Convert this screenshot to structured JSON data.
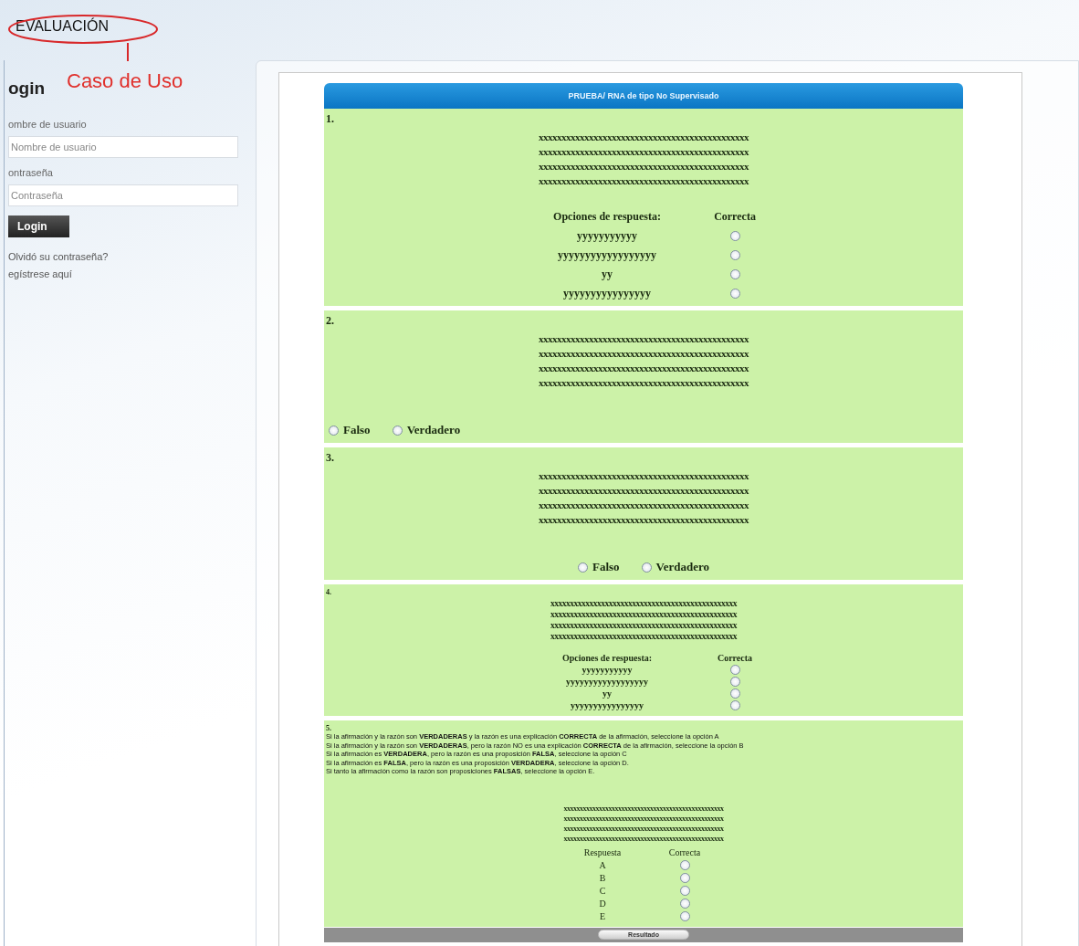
{
  "header": {
    "title": "EVALUACIÓN"
  },
  "annotation": {
    "label": "Caso de Uso"
  },
  "login": {
    "heading": "ogin",
    "fields": [
      {
        "label": "ombre de usuario",
        "placeholder": "Nombre de usuario"
      },
      {
        "label": "ontraseña",
        "placeholder": "Contraseña"
      }
    ],
    "button": "Login",
    "links": [
      "Olvidó su contraseña?",
      "egístrese aquí"
    ]
  },
  "test": {
    "title": "PRUEBA/ RNA de tipo No Supervisado",
    "questions": [
      {
        "kind": "multiple",
        "number": "1.",
        "statement": [
          "xxxxxxxxxxxxxxxxxxxxxxxxxxxxxxxxxxxxxxxxxxxxxx",
          "xxxxxxxxxxxxxxxxxxxxxxxxxxxxxxxxxxxxxxxxxxxxxx",
          "xxxxxxxxxxxxxxxxxxxxxxxxxxxxxxxxxxxxxxxxxxxxxx",
          "xxxxxxxxxxxxxxxxxxxxxxxxxxxxxxxxxxxxxxxxxxxxxx"
        ],
        "options_header": "Opciones de respuesta:",
        "correct_header": "Correcta",
        "options": [
          {
            "text": "yyyyyyyyyyy",
            "selected": false
          },
          {
            "text": "yyyyyyyyyyyyyyyyyy",
            "selected": false
          },
          {
            "text": "yy",
            "selected": false
          },
          {
            "text": "yyyyyyyyyyyyyyyy",
            "selected": false
          }
        ]
      },
      {
        "kind": "truefalse",
        "number": "2.",
        "centered": false,
        "statement": [
          "xxxxxxxxxxxxxxxxxxxxxxxxxxxxxxxxxxxxxxxxxxxxxx",
          "xxxxxxxxxxxxxxxxxxxxxxxxxxxxxxxxxxxxxxxxxxxxxx",
          "xxxxxxxxxxxxxxxxxxxxxxxxxxxxxxxxxxxxxxxxxxxxxx",
          "xxxxxxxxxxxxxxxxxxxxxxxxxxxxxxxxxxxxxxxxxxxxxx"
        ],
        "options": [
          {
            "text": "Falso",
            "selected": false
          },
          {
            "text": "Verdadero",
            "selected": false
          }
        ]
      },
      {
        "kind": "truefalse",
        "number": "3.",
        "centered": true,
        "statement": [
          "xxxxxxxxxxxxxxxxxxxxxxxxxxxxxxxxxxxxxxxxxxxxxx",
          "xxxxxxxxxxxxxxxxxxxxxxxxxxxxxxxxxxxxxxxxxxxxxx",
          "xxxxxxxxxxxxxxxxxxxxxxxxxxxxxxxxxxxxxxxxxxxxxx",
          "xxxxxxxxxxxxxxxxxxxxxxxxxxxxxxxxxxxxxxxxxxxxxx"
        ],
        "options": [
          {
            "text": "Falso",
            "selected": false
          },
          {
            "text": "Verdadero",
            "selected": false
          }
        ]
      },
      {
        "kind": "multiple",
        "number": "4.",
        "statement": [
          "xxxxxxxxxxxxxxxxxxxxxxxxxxxxxxxxxxxxxxxxxxxxxxxx",
          "xxxxxxxxxxxxxxxxxxxxxxxxxxxxxxxxxxxxxxxxxxxxxxxx",
          "xxxxxxxxxxxxxxxxxxxxxxxxxxxxxxxxxxxxxxxxxxxxxxxx",
          "xxxxxxxxxxxxxxxxxxxxxxxxxxxxxxxxxxxxxxxxxxxxxxxx"
        ],
        "options_header": "Opciones de respuesta:",
        "correct_header": "Correcta",
        "options": [
          {
            "text": "yyyyyyyyyyy",
            "selected": false
          },
          {
            "text": "yyyyyyyyyyyyyyyyyy",
            "selected": false
          },
          {
            "text": "yy",
            "selected": false
          },
          {
            "text": "yyyyyyyyyyyyyyyy",
            "selected": false
          }
        ]
      },
      {
        "kind": "assertion",
        "number": "5.",
        "instructions": [
          "Si la afirmación y la razón son **VERDADERAS** y la razón es una explicación **CORRECTA** de la afirmación, seleccione la opción A",
          "Si la afirmación y la razón son **VERDADERAS**, pero la razón NO es una explicación **CORRECTA** de la afirmación, seleccione la opción B",
          "Si la afirmación es **VERDADERA**, pero la razón es una proposición **FALSA**, seleccione la opción C",
          "Si la afirmación es **FALSA**, pero la razón es una proposición **VERDADERA**, seleccione la opción D.",
          "Si tanto la afirmación como la razón son proposiciones **FALSAS**, seleccione la opción E."
        ],
        "statement": [
          "xxxxxxxxxxxxxxxxxxxxxxxxxxxxxxxxxxxxxxxxxxxxxxxxxx",
          "xxxxxxxxxxxxxxxxxxxxxxxxxxxxxxxxxxxxxxxxxxxxxxxxxx",
          "xxxxxxxxxxxxxxxxxxxxxxxxxxxxxxxxxxxxxxxxxxxxxxxxxx",
          "xxxxxxxxxxxxxxxxxxxxxxxxxxxxxxxxxxxxxxxxxxxxxxxxxx"
        ],
        "options_header": "Respuesta",
        "correct_header": "Correcta",
        "options": [
          {
            "text": "A",
            "selected": false
          },
          {
            "text": "B",
            "selected": false
          },
          {
            "text": "C",
            "selected": false
          },
          {
            "text": "D",
            "selected": false
          },
          {
            "text": "E",
            "selected": false
          }
        ]
      }
    ],
    "submit": "Resultado"
  }
}
